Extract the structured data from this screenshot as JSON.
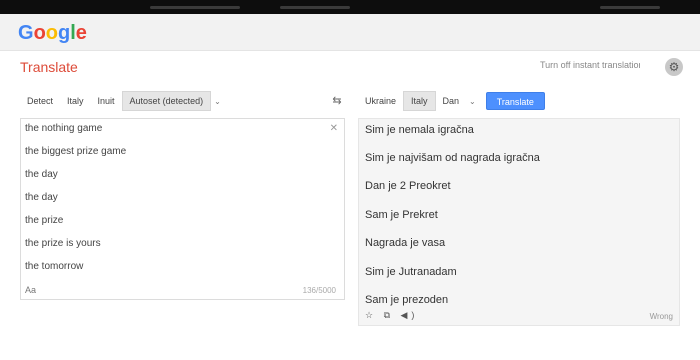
{
  "logo": {
    "text": "Google",
    "letters": [
      {
        "ch": "G",
        "color": "#4285f4"
      },
      {
        "ch": "o",
        "color": "#ea4335"
      },
      {
        "ch": "o",
        "color": "#fbbc05"
      },
      {
        "ch": "g",
        "color": "#4285f4"
      },
      {
        "ch": "l",
        "color": "#34a853"
      },
      {
        "ch": "e",
        "color": "#ea4335"
      }
    ]
  },
  "header": {
    "title": "Translate",
    "turn_off": "Turn off instant translation",
    "settings_icon": "gear-icon"
  },
  "source": {
    "tabs": [
      "Detect",
      "Italy",
      "Inuit",
      "Autoset (detected)"
    ],
    "active_tab": 3,
    "items": [
      "the nothing game",
      "the biggest prize game",
      "the day",
      "the day",
      "the prize",
      "the prize is yours",
      "the tomorrow"
    ],
    "footer": "Aa",
    "char_count": "136/5000"
  },
  "target": {
    "tabs": [
      "Ukraine",
      "Italy",
      "Dan"
    ],
    "active_tab": 1,
    "translate_label": "Translate",
    "lines": [
      "Sim je nemala igračna",
      "Sim je najvišam od nagrada igračna",
      "Dan je 2 Preokret",
      "Sam je Prekret",
      "Nagrada je vasa",
      "Sim je Jutranadam",
      "Sam je prezoden"
    ],
    "footer_icons": "☆ ⧉ ◀)",
    "footer_right": "Wrong"
  },
  "colors": {
    "accent": "#4d90fe",
    "title_red": "#dd4b39"
  }
}
